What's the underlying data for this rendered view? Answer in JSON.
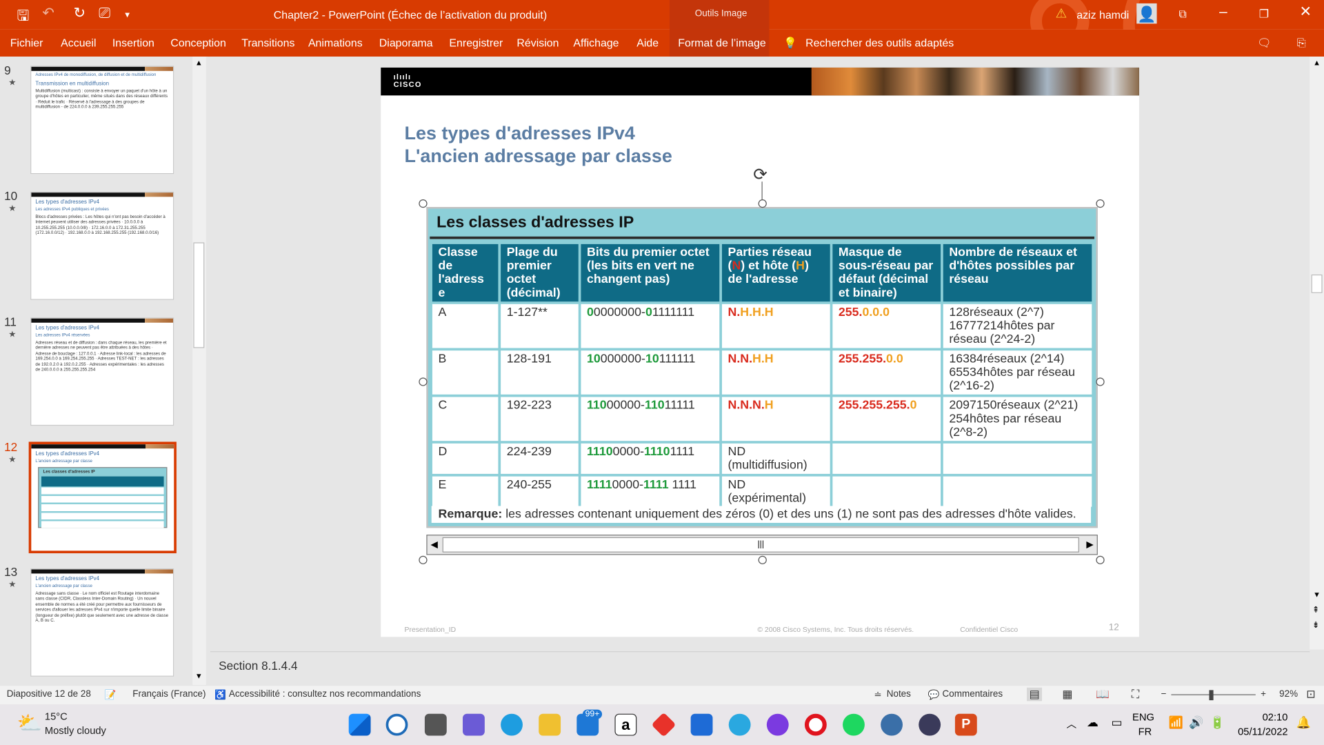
{
  "titlebar": {
    "title": "Chapter2  -  PowerPoint (Échec de l’activation du produit)",
    "context": "Outils Image",
    "user": "aziz hamdi"
  },
  "menu": [
    "Fichier",
    "Accueil",
    "Insertion",
    "Conception",
    "Transitions",
    "Animations",
    "Diaporama",
    "Enregistrer",
    "Révision",
    "Affichage",
    "Aide",
    "Format de l’image"
  ],
  "search_tools": "Rechercher des outils adaptés",
  "thumbnails": [
    {
      "num": "9",
      "title": "Transmission en multidiffusion",
      "sub": "Adresses IPv4 de monodiffusion, de diffusion et de multidiffusion",
      "text": "Multidiffusion (multicast) : consiste à envoyer un paquet d'un hôte à un groupe d'hôtes en particulier, même situés dans des réseaux différents · Réduit le trafic · Réservé à l'adressage à des groupes de multidiffusion - de 224.0.0.0 à 239.255.255.255"
    },
    {
      "num": "10",
      "title": "Les types d'adresses IPv4",
      "sub": "Les adresses IPv4 publiques et privées",
      "text": "Blocs d'adresses privées : Les hôtes qui n'ont pas besoin d'accéder à Internet peuvent utiliser des adresses privées · 10.0.0.0 à 10.255.255.255 (10.0.0.0/8) · 172.16.0.0 à 172.31.255.255 (172.16.0.0/12) · 192.168.0.0 à 192.168.255.255 (192.168.0.0/16)"
    },
    {
      "num": "11",
      "title": "Les types d'adresses IPv4",
      "sub": "Les adresses IPv4 réservées",
      "text": "Adresses réseau et de diffusion : dans chaque réseau, les première et dernière adresses ne peuvent pas être attribuées à des hôtes · Adresse de bouclage : 127.0.0.1 · Adresse link-local : les adresses de 169.254.0.0 à 169.254.255.255 · Adresses TEST-NET : les adresses de 192.0.2.0 à 192.0.2.255 · Adresses expérimentales : les adresses de 240.0.0.0 à 255.255.255.254"
    },
    {
      "num": "12",
      "title": "Les types d'adresses IPv4",
      "sub": "L'ancien adressage par classe",
      "text": "Les classes d'adresses IP"
    },
    {
      "num": "13",
      "title": "Les types d'adresses IPv4",
      "sub": "L'ancien adressage par classe",
      "text": "Adressage sans classe · Le nom officiel est Routage interdomaine sans classe (CIDR, Classless Inter-Domain Routing) · Un nouvel ensemble de normes a été créé pour permettre aux fournisseurs de services d'allouer les adresses IPv4 sur n'importe quelle limite binaire (longueur de préfixe) plutôt que seulement avec une adresse de classe A, B ou C."
    }
  ],
  "slide": {
    "logo": "CISCO",
    "title_line1": "Les types d'adresses IPv4",
    "title_line2": "L'ancien adressage par classe",
    "table_caption": "Les classes d'adresses IP",
    "headers": [
      "Classe de l'adress e",
      "Plage du premier octet (décimal)",
      "Bits du premier octet (les bits en vert ne changent pas)",
      "Parties réseau (N) et hôte (H) de l'adresse",
      "Masque de sous-réseau par défaut (décimal et binaire)",
      "Nombre de réseaux et d'hôtes possibles par réseau"
    ],
    "rows": [
      {
        "cls": "A",
        "range": "1-127**",
        "bits_g1": "0",
        "bits_r1": "0000000-",
        "bits_g2": "0",
        "bits_r2": "1111111",
        "parts_r": "N.",
        "parts_o": "H.H.H",
        "mask_r": "255.",
        "mask_o": "0.0.0",
        "count": "128réseaux (2^7) 16777214hôtes par réseau (2^24-2)"
      },
      {
        "cls": "B",
        "range": "128-191",
        "bits_g1": "10",
        "bits_r1": "000000-",
        "bits_g2": "10",
        "bits_r2": "111111",
        "parts_r": "N.N.",
        "parts_o": "H.H",
        "mask_r": "255.255.",
        "mask_o": "0.0",
        "count": "16384réseaux (2^14) 65534hôtes par réseau (2^16-2)"
      },
      {
        "cls": "C",
        "range": "192-223",
        "bits_g1": "110",
        "bits_r1": "00000-",
        "bits_g2": "110",
        "bits_r2": "11111",
        "parts_r": "N.N.N.",
        "parts_o": "H",
        "mask_r": "255.255.255.",
        "mask_o": "0",
        "count": "2097150réseaux (2^21) 254hôtes par réseau (2^8-2)"
      },
      {
        "cls": "D",
        "range": "224-239",
        "bits_g1": "1110",
        "bits_r1": "0000-",
        "bits_g2": "1110",
        "bits_r2": "1111",
        "parts": "ND (multidiffusion)"
      },
      {
        "cls": "E",
        "range": "240-255",
        "bits_g1": "1111",
        "bits_r1": "0000-",
        "bits_g2": "1111",
        "bits_r2": " 1111",
        "parts": "ND (expérimental)"
      }
    ],
    "note_bold": "Remarque:",
    "note_text": " les adresses contenant uniquement des zéros (0) et des uns (1) ne sont pas des adresses d'hôte valides.",
    "footer_left": "Presentation_ID",
    "footer_center": "© 2008 Cisco Systems, Inc. Tous droits réservés.",
    "footer_right": "Confidentiel Cisco",
    "page": "12"
  },
  "notes_text": "Section 8.1.4.4",
  "status": {
    "slide": "Diapositive 12 de 28",
    "lang": "Français (France)",
    "access": "Accessibilité : consultez nos recommandations",
    "notes": "Notes",
    "comments": "Commentaires",
    "zoom": "92%"
  },
  "taskbar": {
    "temp": "15°C",
    "weather": "Mostly cloudy",
    "lang1": "ENG",
    "lang2": "FR",
    "time": "02:10",
    "date": "05/11/2022",
    "badge": "99+"
  }
}
